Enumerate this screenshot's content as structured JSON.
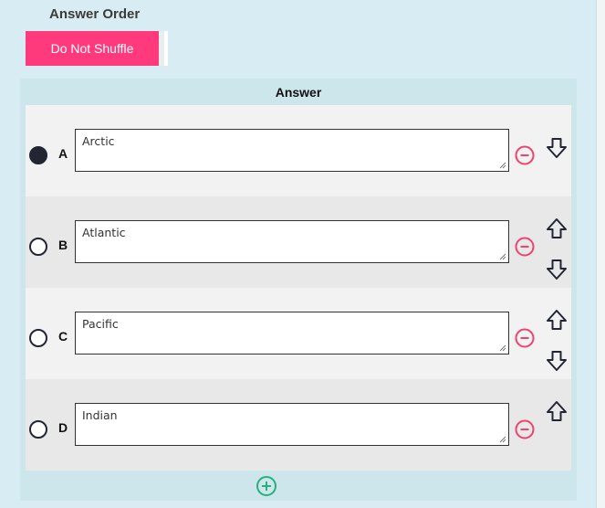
{
  "answer_order": {
    "title": "Answer Order",
    "shuffle_button": "Do Not Shuffle"
  },
  "answer_section": {
    "header": "Answer",
    "answers": [
      {
        "letter": "A",
        "text": "Arctic",
        "selected": true
      },
      {
        "letter": "B",
        "text": "Atlantic",
        "selected": false
      },
      {
        "letter": "C",
        "text": "Pacific",
        "selected": false
      },
      {
        "letter": "D",
        "text": "Indian",
        "selected": false
      }
    ]
  },
  "colors": {
    "accent": "#ff3a7c",
    "remove_icon": "#f0426e",
    "add_icon": "#27b07a",
    "panel_bg": "#cde6ec",
    "page_bg": "#d8edf3"
  },
  "icons": {
    "remove": "minus-circle-icon",
    "move_up": "arrow-up-icon",
    "move_down": "arrow-down-icon",
    "add": "plus-circle-icon",
    "resize": "resize-grip-icon"
  }
}
